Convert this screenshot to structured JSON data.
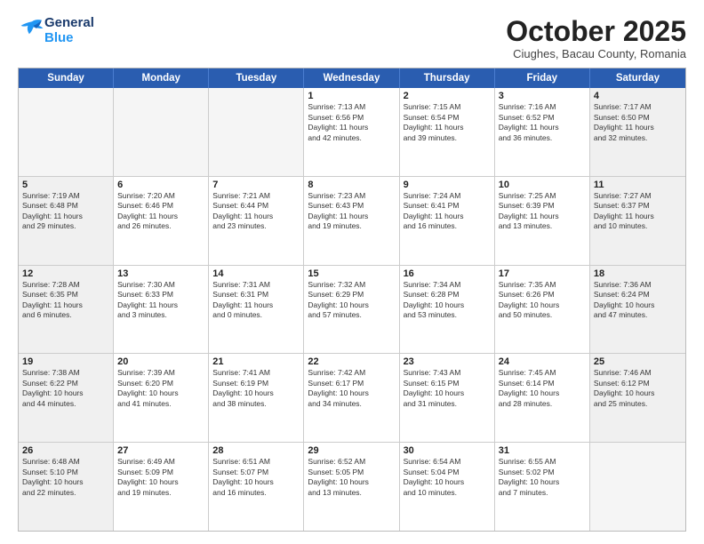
{
  "header": {
    "logo_line1": "General",
    "logo_line2": "Blue",
    "month": "October 2025",
    "location": "Ciughes, Bacau County, Romania"
  },
  "days_of_week": [
    "Sunday",
    "Monday",
    "Tuesday",
    "Wednesday",
    "Thursday",
    "Friday",
    "Saturday"
  ],
  "rows": [
    [
      {
        "day": "",
        "empty": true
      },
      {
        "day": "",
        "empty": true
      },
      {
        "day": "",
        "empty": true
      },
      {
        "day": "1",
        "lines": [
          "Sunrise: 7:13 AM",
          "Sunset: 6:56 PM",
          "Daylight: 11 hours",
          "and 42 minutes."
        ]
      },
      {
        "day": "2",
        "lines": [
          "Sunrise: 7:15 AM",
          "Sunset: 6:54 PM",
          "Daylight: 11 hours",
          "and 39 minutes."
        ]
      },
      {
        "day": "3",
        "lines": [
          "Sunrise: 7:16 AM",
          "Sunset: 6:52 PM",
          "Daylight: 11 hours",
          "and 36 minutes."
        ]
      },
      {
        "day": "4",
        "lines": [
          "Sunrise: 7:17 AM",
          "Sunset: 6:50 PM",
          "Daylight: 11 hours",
          "and 32 minutes."
        ]
      }
    ],
    [
      {
        "day": "5",
        "lines": [
          "Sunrise: 7:19 AM",
          "Sunset: 6:48 PM",
          "Daylight: 11 hours",
          "and 29 minutes."
        ]
      },
      {
        "day": "6",
        "lines": [
          "Sunrise: 7:20 AM",
          "Sunset: 6:46 PM",
          "Daylight: 11 hours",
          "and 26 minutes."
        ]
      },
      {
        "day": "7",
        "lines": [
          "Sunrise: 7:21 AM",
          "Sunset: 6:44 PM",
          "Daylight: 11 hours",
          "and 23 minutes."
        ]
      },
      {
        "day": "8",
        "lines": [
          "Sunrise: 7:23 AM",
          "Sunset: 6:43 PM",
          "Daylight: 11 hours",
          "and 19 minutes."
        ]
      },
      {
        "day": "9",
        "lines": [
          "Sunrise: 7:24 AM",
          "Sunset: 6:41 PM",
          "Daylight: 11 hours",
          "and 16 minutes."
        ]
      },
      {
        "day": "10",
        "lines": [
          "Sunrise: 7:25 AM",
          "Sunset: 6:39 PM",
          "Daylight: 11 hours",
          "and 13 minutes."
        ]
      },
      {
        "day": "11",
        "lines": [
          "Sunrise: 7:27 AM",
          "Sunset: 6:37 PM",
          "Daylight: 11 hours",
          "and 10 minutes."
        ]
      }
    ],
    [
      {
        "day": "12",
        "lines": [
          "Sunrise: 7:28 AM",
          "Sunset: 6:35 PM",
          "Daylight: 11 hours",
          "and 6 minutes."
        ]
      },
      {
        "day": "13",
        "lines": [
          "Sunrise: 7:30 AM",
          "Sunset: 6:33 PM",
          "Daylight: 11 hours",
          "and 3 minutes."
        ]
      },
      {
        "day": "14",
        "lines": [
          "Sunrise: 7:31 AM",
          "Sunset: 6:31 PM",
          "Daylight: 11 hours",
          "and 0 minutes."
        ]
      },
      {
        "day": "15",
        "lines": [
          "Sunrise: 7:32 AM",
          "Sunset: 6:29 PM",
          "Daylight: 10 hours",
          "and 57 minutes."
        ]
      },
      {
        "day": "16",
        "lines": [
          "Sunrise: 7:34 AM",
          "Sunset: 6:28 PM",
          "Daylight: 10 hours",
          "and 53 minutes."
        ]
      },
      {
        "day": "17",
        "lines": [
          "Sunrise: 7:35 AM",
          "Sunset: 6:26 PM",
          "Daylight: 10 hours",
          "and 50 minutes."
        ]
      },
      {
        "day": "18",
        "lines": [
          "Sunrise: 7:36 AM",
          "Sunset: 6:24 PM",
          "Daylight: 10 hours",
          "and 47 minutes."
        ]
      }
    ],
    [
      {
        "day": "19",
        "lines": [
          "Sunrise: 7:38 AM",
          "Sunset: 6:22 PM",
          "Daylight: 10 hours",
          "and 44 minutes."
        ]
      },
      {
        "day": "20",
        "lines": [
          "Sunrise: 7:39 AM",
          "Sunset: 6:20 PM",
          "Daylight: 10 hours",
          "and 41 minutes."
        ]
      },
      {
        "day": "21",
        "lines": [
          "Sunrise: 7:41 AM",
          "Sunset: 6:19 PM",
          "Daylight: 10 hours",
          "and 38 minutes."
        ]
      },
      {
        "day": "22",
        "lines": [
          "Sunrise: 7:42 AM",
          "Sunset: 6:17 PM",
          "Daylight: 10 hours",
          "and 34 minutes."
        ]
      },
      {
        "day": "23",
        "lines": [
          "Sunrise: 7:43 AM",
          "Sunset: 6:15 PM",
          "Daylight: 10 hours",
          "and 31 minutes."
        ]
      },
      {
        "day": "24",
        "lines": [
          "Sunrise: 7:45 AM",
          "Sunset: 6:14 PM",
          "Daylight: 10 hours",
          "and 28 minutes."
        ]
      },
      {
        "day": "25",
        "lines": [
          "Sunrise: 7:46 AM",
          "Sunset: 6:12 PM",
          "Daylight: 10 hours",
          "and 25 minutes."
        ]
      }
    ],
    [
      {
        "day": "26",
        "lines": [
          "Sunrise: 6:48 AM",
          "Sunset: 5:10 PM",
          "Daylight: 10 hours",
          "and 22 minutes."
        ]
      },
      {
        "day": "27",
        "lines": [
          "Sunrise: 6:49 AM",
          "Sunset: 5:09 PM",
          "Daylight: 10 hours",
          "and 19 minutes."
        ]
      },
      {
        "day": "28",
        "lines": [
          "Sunrise: 6:51 AM",
          "Sunset: 5:07 PM",
          "Daylight: 10 hours",
          "and 16 minutes."
        ]
      },
      {
        "day": "29",
        "lines": [
          "Sunrise: 6:52 AM",
          "Sunset: 5:05 PM",
          "Daylight: 10 hours",
          "and 13 minutes."
        ]
      },
      {
        "day": "30",
        "lines": [
          "Sunrise: 6:54 AM",
          "Sunset: 5:04 PM",
          "Daylight: 10 hours",
          "and 10 minutes."
        ]
      },
      {
        "day": "31",
        "lines": [
          "Sunrise: 6:55 AM",
          "Sunset: 5:02 PM",
          "Daylight: 10 hours",
          "and 7 minutes."
        ]
      },
      {
        "day": "",
        "empty": true
      }
    ]
  ]
}
